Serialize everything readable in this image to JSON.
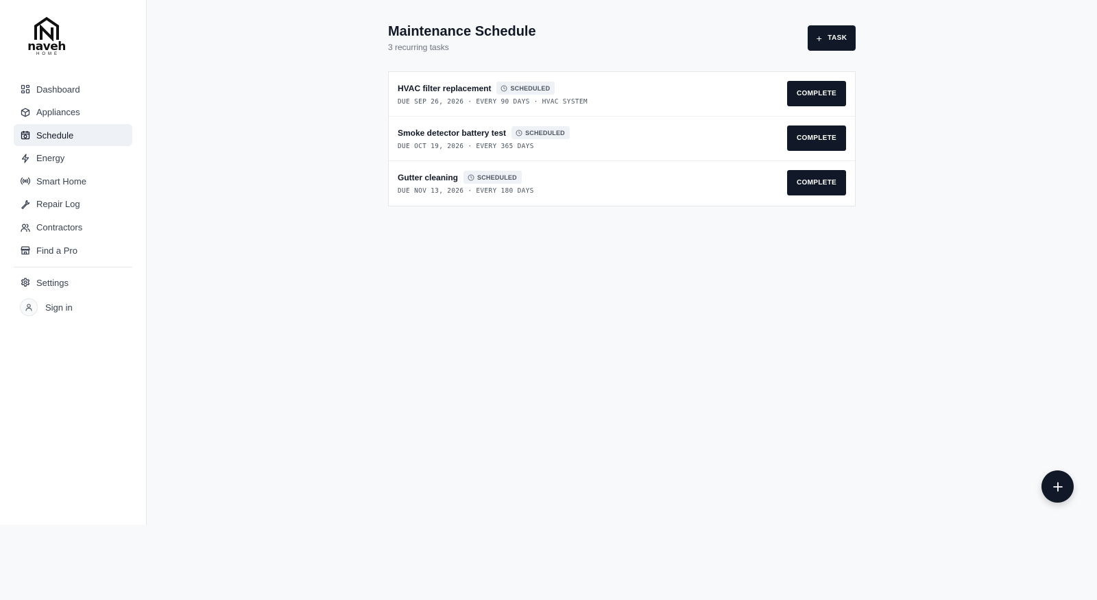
{
  "brand": {
    "name": "naveh",
    "tagline": "HOME",
    "logo_icon": "house-n-logo"
  },
  "sidebar": {
    "items": [
      {
        "label": "Dashboard",
        "icon": "grid-icon"
      },
      {
        "label": "Appliances",
        "icon": "box-icon"
      },
      {
        "label": "Schedule",
        "icon": "calendar-clock-icon",
        "active": true
      },
      {
        "label": "Energy",
        "icon": "bolt-icon"
      },
      {
        "label": "Smart Home",
        "icon": "radio-icon"
      },
      {
        "label": "Repair Log",
        "icon": "wrench-icon"
      },
      {
        "label": "Contractors",
        "icon": "users-icon"
      },
      {
        "label": "Find a Pro",
        "icon": "store-icon"
      }
    ],
    "settings": {
      "label": "Settings",
      "icon": "gear-icon"
    },
    "signin": {
      "label": "Sign in",
      "icon": "user-icon"
    }
  },
  "main": {
    "title": "Maintenance Schedule",
    "subtitle": "3 recurring tasks",
    "add_task_label": "TASK",
    "tasks": [
      {
        "name": "HVAC filter replacement",
        "status": "SCHEDULED",
        "meta": "DUE SEP 26, 2026 · EVERY 90 DAYS · HVAC SYSTEM",
        "action": "COMPLETE"
      },
      {
        "name": "Smoke detector battery test",
        "status": "SCHEDULED",
        "meta": "DUE OCT 19, 2026 · EVERY 365 DAYS",
        "action": "COMPLETE"
      },
      {
        "name": "Gutter cleaning",
        "status": "SCHEDULED",
        "meta": "DUE NOV 13, 2026 · EVERY 180 DAYS",
        "action": "COMPLETE"
      }
    ]
  },
  "fab": {
    "icon": "plus-icon"
  },
  "colors": {
    "accent": "#111827",
    "active_nav_bg": "#eef1f5",
    "page_bg": "#f8f9fb"
  }
}
